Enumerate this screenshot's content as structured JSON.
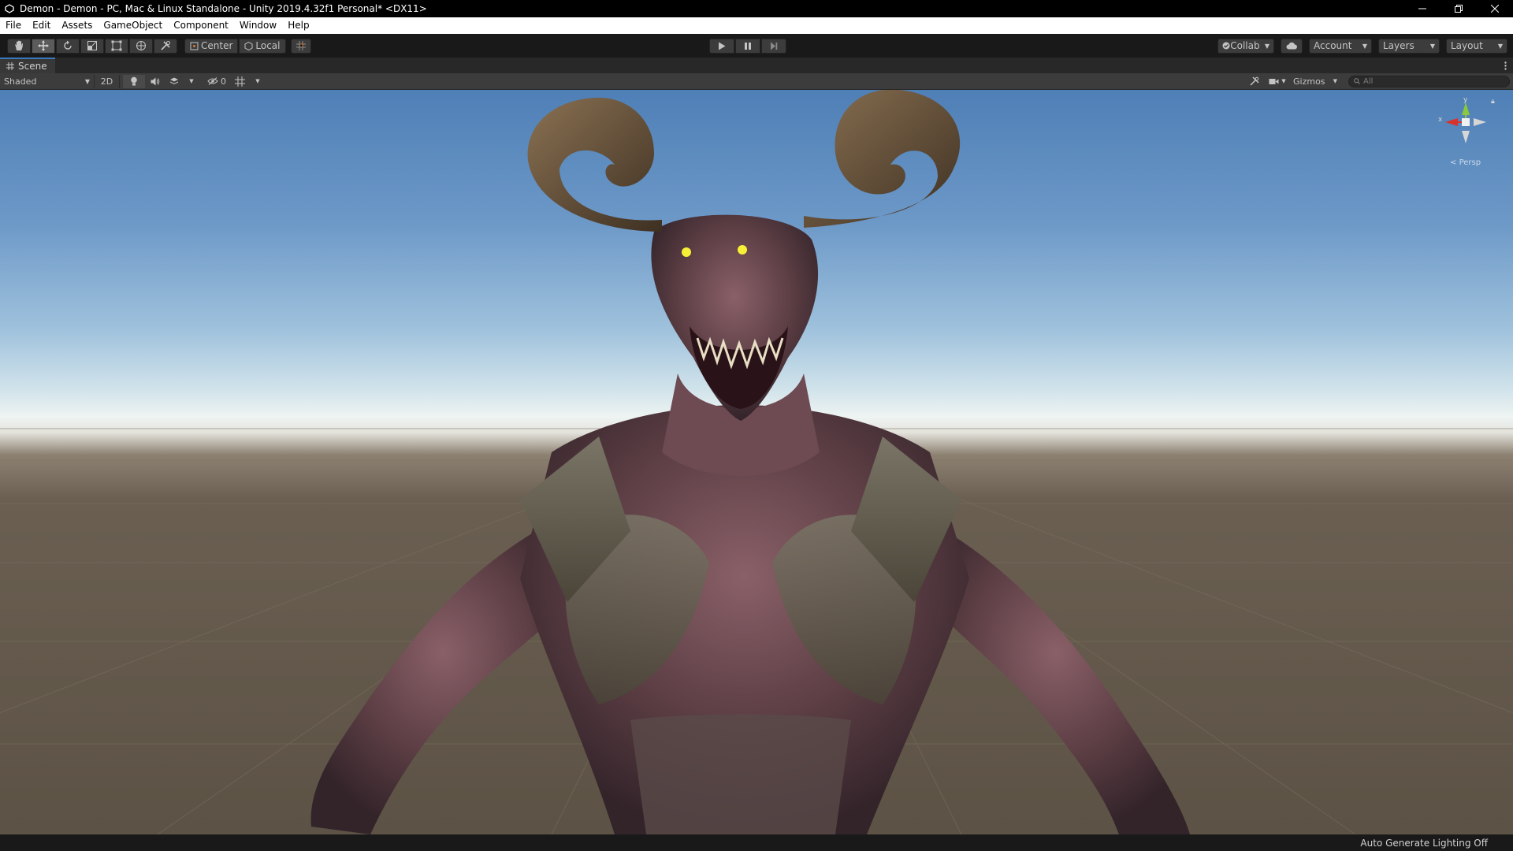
{
  "window": {
    "title": "Demon - Demon - PC, Mac & Linux Standalone - Unity 2019.4.32f1 Personal* <DX11>"
  },
  "menu": [
    "File",
    "Edit",
    "Assets",
    "GameObject",
    "Component",
    "Window",
    "Help"
  ],
  "toolbar": {
    "pivot_label": "Center",
    "space_label": "Local",
    "collab_label": "Collab",
    "account_label": "Account",
    "layers_label": "Layers",
    "layout_label": "Layout"
  },
  "scene_tab": {
    "label": "Scene"
  },
  "scene_toolbar": {
    "draw_mode": "Shaded",
    "mode_2d": "2D",
    "hidden_count": "0",
    "gizmos_label": "Gizmos",
    "search_placeholder": "All"
  },
  "gizmo": {
    "y_label": "y",
    "x_label": "x",
    "projection": "Persp"
  },
  "status": {
    "text": "Auto Generate Lighting Off"
  },
  "colors": {
    "accent": "#3a79bb",
    "gizmo_x": "#d8322c",
    "gizmo_y": "#8ac83c"
  }
}
